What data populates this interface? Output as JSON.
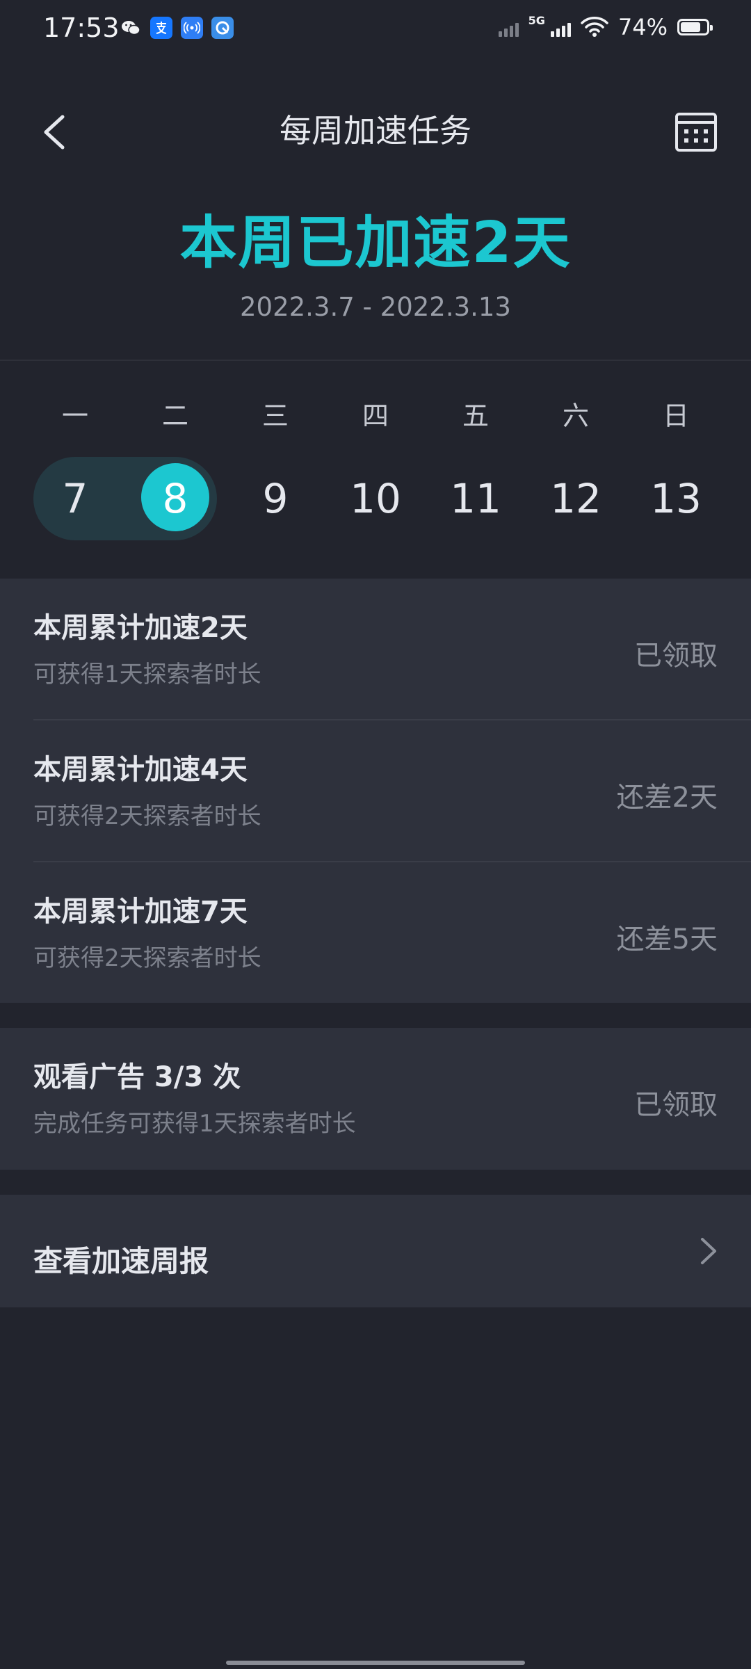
{
  "status_bar": {
    "time": "17:53",
    "network": "5G",
    "battery": "74%"
  },
  "header": {
    "title": "每周加速任务"
  },
  "summary": {
    "title": "本周已加速2天",
    "date_range": "2022.3.7  -  2022.3.13"
  },
  "week": {
    "labels": [
      "一",
      "二",
      "三",
      "四",
      "五",
      "六",
      "日"
    ],
    "days": [
      "7",
      "8",
      "9",
      "10",
      "11",
      "12",
      "13"
    ]
  },
  "tasks": [
    {
      "title": "本周累计加速2天",
      "subtitle": "可获得1天探索者时长",
      "status": "已领取"
    },
    {
      "title": "本周累计加速4天",
      "subtitle": "可获得2天探索者时长",
      "status": "还差2天"
    },
    {
      "title": "本周累计加速7天",
      "subtitle": "可获得2天探索者时长",
      "status": "还差5天"
    }
  ],
  "ad_task": {
    "title": "观看广告  3/3  次",
    "subtitle": "完成任务可获得1天探索者时长",
    "status": "已领取"
  },
  "report": {
    "label": "查看加速周报"
  },
  "colors": {
    "accent": "#1cc7d0",
    "background": "#22242d",
    "card": "#2e313c"
  }
}
